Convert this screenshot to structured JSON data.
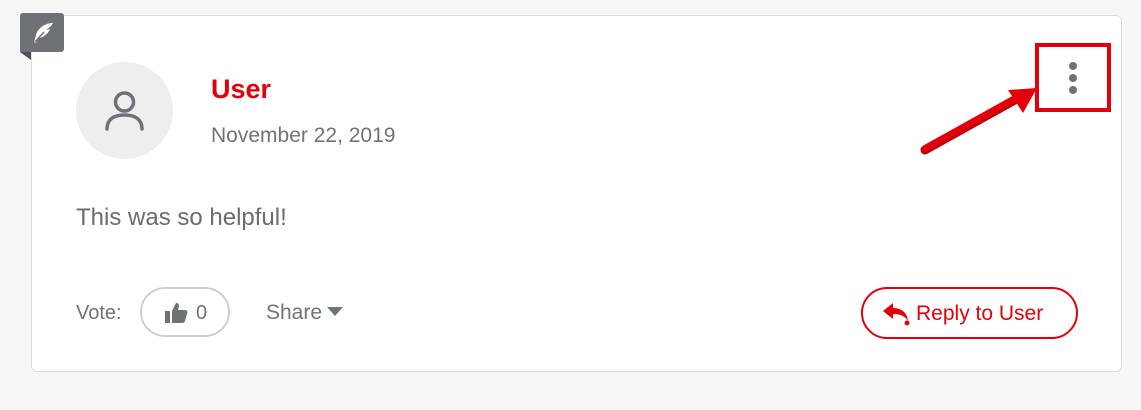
{
  "comment": {
    "author": "User",
    "date": "November 22, 2019",
    "body": "This was so helpful!"
  },
  "footer": {
    "vote_label": "Vote:",
    "vote_count": "0",
    "share_label": "Share",
    "reply_label": "Reply to User"
  },
  "icons": {
    "badge": "feather-icon",
    "avatar": "user-icon",
    "vote": "thumbs-up-icon",
    "share": "caret-down-icon",
    "reply": "reply-arrow-icon",
    "menu": "vertical-ellipsis-icon"
  },
  "colors": {
    "accent": "#e3000b",
    "muted_text": "#6c757d",
    "badge": "#6e7176"
  }
}
